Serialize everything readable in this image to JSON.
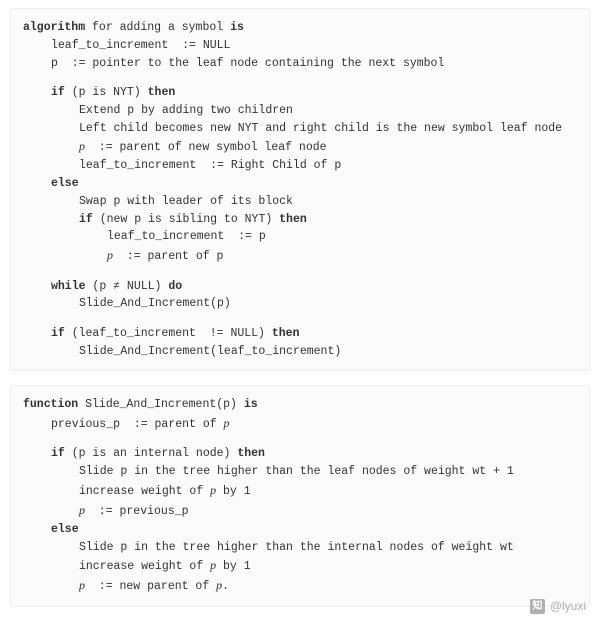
{
  "alg": {
    "head_kw1": "algorithm",
    "head_txt": " for adding a symbol ",
    "head_kw2": "is",
    "l_init_leaf": "leaf_to_increment  := NULL",
    "l_init_p": "p  := pointer to the leaf node containing the next symbol",
    "if_kw": "if",
    "if_cond": " (p is NYT) ",
    "then_kw": "then",
    "l_extend": "Extend p by adding two children",
    "l_children": "Left child becomes new NYT and right child is the new symbol leaf node",
    "l_passign_pre": "  := parent of new symbol leaf node",
    "l_leaf_rc": "leaf_to_increment  := Right Child of p",
    "else_kw": "else",
    "l_swap": "Swap p with leader of its block",
    "if2_kw": "if",
    "if2_cond": " (new p is sibling to NYT) ",
    "l_leaf_p": "leaf_to_increment  := p",
    "l_p_parent": "  := parent of p",
    "while_kw": "while",
    "while_cond": " (p ≠ NULL) ",
    "do_kw": "do",
    "l_slide_p": "Slide_And_Increment(p)",
    "if3_kw": "if",
    "if3_cond": " (leaf_to_increment  != NULL) ",
    "l_slide_leaf": "Slide_And_Increment(leaf_to_increment)",
    "p_var": "p"
  },
  "fn": {
    "head_kw1": "function",
    "head_txt1": " Slide_And_Increment(p) ",
    "head_kw2": "is",
    "l_prev": "previous_p  := parent of ",
    "if_kw": "if",
    "if_cond": " (p is an internal node) ",
    "then_kw": "then",
    "l_slide_leaf": "Slide p in the tree higher than the leaf nodes of weight wt + 1",
    "l_inc_pre": "increase weight of ",
    "l_inc_post": " by 1",
    "l_p_prev": "  := previous_p",
    "else_kw": "else",
    "l_slide_int": "Slide p in the tree higher than the internal nodes of weight wt",
    "l_p_newparent_pre": "  := new parent of ",
    "l_p_newparent_post": ".",
    "p_var": "p"
  },
  "watermark": {
    "logo": "知",
    "text": "@lyuxi"
  }
}
